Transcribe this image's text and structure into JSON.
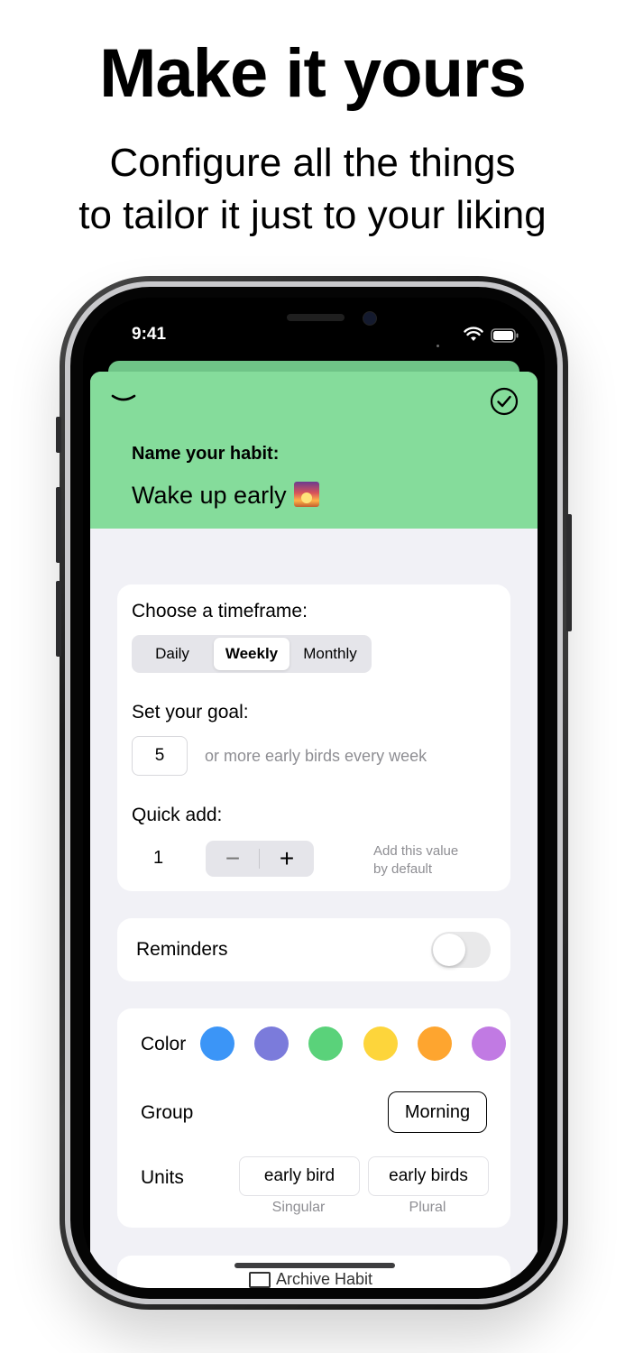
{
  "marketing": {
    "headline": "Make it yours",
    "subline_1": "Configure all the things",
    "subline_2": "to tailor it just to your liking"
  },
  "status_bar": {
    "time": "9:41"
  },
  "header": {
    "name_label": "Name your habit:",
    "habit_name": "Wake up early"
  },
  "timeframe": {
    "label": "Choose a timeframe:",
    "options": [
      "Daily",
      "Weekly",
      "Monthly"
    ],
    "selected": "Weekly"
  },
  "goal": {
    "label": "Set your goal:",
    "value": "5",
    "suffix": "or more early birds every week"
  },
  "quick_add": {
    "label": "Quick add:",
    "value": "1",
    "minus": "−",
    "plus": "+",
    "hint_1": "Add this value",
    "hint_2": "by default"
  },
  "reminders": {
    "label": "Reminders",
    "enabled": false
  },
  "appearance": {
    "color_label": "Color",
    "colors": [
      "#3b95f7",
      "#7b7bdb",
      "#5ad27a",
      "#fdd53b",
      "#fea52f",
      "#c17ae3"
    ],
    "group_label": "Group",
    "group_value": "Morning",
    "units_label": "Units",
    "unit_singular": "early bird",
    "unit_plural": "early birds",
    "singular_caption": "Singular",
    "plural_caption": "Plural"
  },
  "footer": {
    "archive_label": "Archive Habit"
  }
}
